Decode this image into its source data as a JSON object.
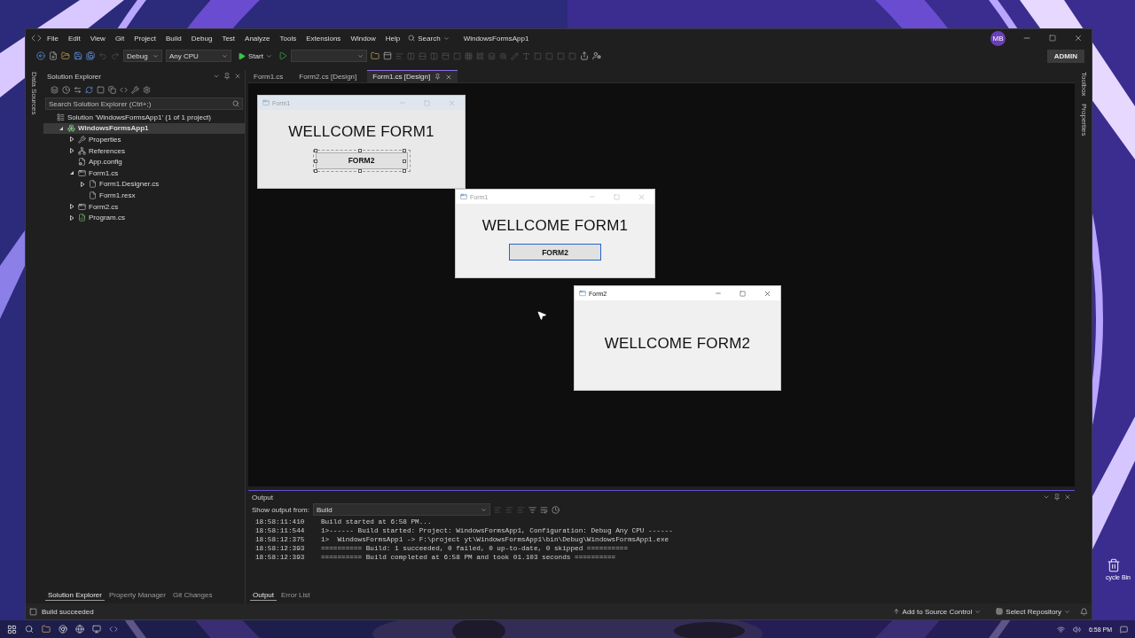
{
  "menu": [
    "File",
    "Edit",
    "View",
    "Git",
    "Project",
    "Build",
    "Debug",
    "Test",
    "Analyze",
    "Tools",
    "Extensions",
    "Window",
    "Help"
  ],
  "search_label": "Search",
  "window_title": "WindowsFormsApp1",
  "account_initials": "MB",
  "toolbar": {
    "configuration": "Debug",
    "platform": "Any CPU",
    "start": "Start"
  },
  "admin_button": "ADMIN",
  "left_strip": "Data Sources",
  "right_strip": [
    "Toolbox",
    "Properties"
  ],
  "solution_explorer": {
    "title": "Solution Explorer",
    "search_placeholder": "Search Solution Explorer (Ctrl+;)",
    "tree": [
      {
        "label": "Solution 'WindowsFormsApp1' (1 of 1 project)",
        "kind": "solution",
        "selected": false,
        "children": [
          {
            "label": "WindowsFormsApp1",
            "kind": "project",
            "selected": true,
            "expanded": true,
            "children": [
              {
                "label": "Properties",
                "kind": "properties",
                "selected": false,
                "expanded": false
              },
              {
                "label": "References",
                "kind": "references",
                "selected": false,
                "expanded": false
              },
              {
                "label": "App.config",
                "kind": "config",
                "selected": false
              },
              {
                "label": "Form1.cs",
                "kind": "form",
                "selected": false,
                "expanded": true,
                "children": [
                  {
                    "label": "Form1.Designer.cs",
                    "kind": "file",
                    "selected": false,
                    "expanded": false
                  },
                  {
                    "label": "Form1.resx",
                    "kind": "file",
                    "selected": false
                  }
                ]
              },
              {
                "label": "Form2.cs",
                "kind": "form",
                "selected": false,
                "expanded": false
              },
              {
                "label": "Program.cs",
                "kind": "csharp",
                "selected": false,
                "expanded": false
              }
            ]
          }
        ]
      }
    ],
    "tabs": [
      {
        "label": "Solution Explorer",
        "selected": true
      },
      {
        "label": "Property Manager",
        "selected": false
      },
      {
        "label": "Git Changes",
        "selected": false
      }
    ]
  },
  "editor_tabs": [
    {
      "label": "Form1.cs",
      "selected": false
    },
    {
      "label": "Form2.cs [Design]",
      "selected": false
    },
    {
      "label": "Form1.cs [Design]",
      "selected": true
    }
  ],
  "designer": {
    "form_title": "Form1",
    "label": "WELLCOME FORM1",
    "button": "FORM2"
  },
  "windows": [
    {
      "title": "Form1",
      "label": "WELLCOME FORM1",
      "button": "FORM2",
      "active": false
    },
    {
      "title": "Form2",
      "label": "WELLCOME FORM2",
      "active": true
    }
  ],
  "output": {
    "title": "Output",
    "source_label": "Show output from:",
    "source": "Build",
    "lines": [
      {
        "time": "18:58:11:410",
        "text": "Build started at 6:58 PM..."
      },
      {
        "time": "18:58:11:544",
        "text": "1>------ Build started: Project: WindowsFormsApp1, Configuration: Debug Any CPU ------"
      },
      {
        "time": "18:58:12:375",
        "text": "1>  WindowsFormsApp1 -> F:\\project yt\\WindowsFormsApp1\\bin\\Debug\\WindowsFormsApp1.exe"
      },
      {
        "time": "18:58:12:393",
        "text": "========== Build: 1 succeeded, 0 failed, 0 up-to-date, 0 skipped =========="
      },
      {
        "time": "18:58:12:393",
        "text": "========== Build completed at 6:58 PM and took 01.103 seconds =========="
      }
    ],
    "tabs": [
      {
        "label": "Output",
        "selected": true
      },
      {
        "label": "Error List",
        "selected": false
      }
    ]
  },
  "status_bar": {
    "message": "Build succeeded",
    "source_control": "Add to Source Control",
    "repository": "Select Repository"
  },
  "desktop": {
    "icon_label": "cycle Bin"
  },
  "taskbar": {
    "time": "6:58 PM"
  }
}
